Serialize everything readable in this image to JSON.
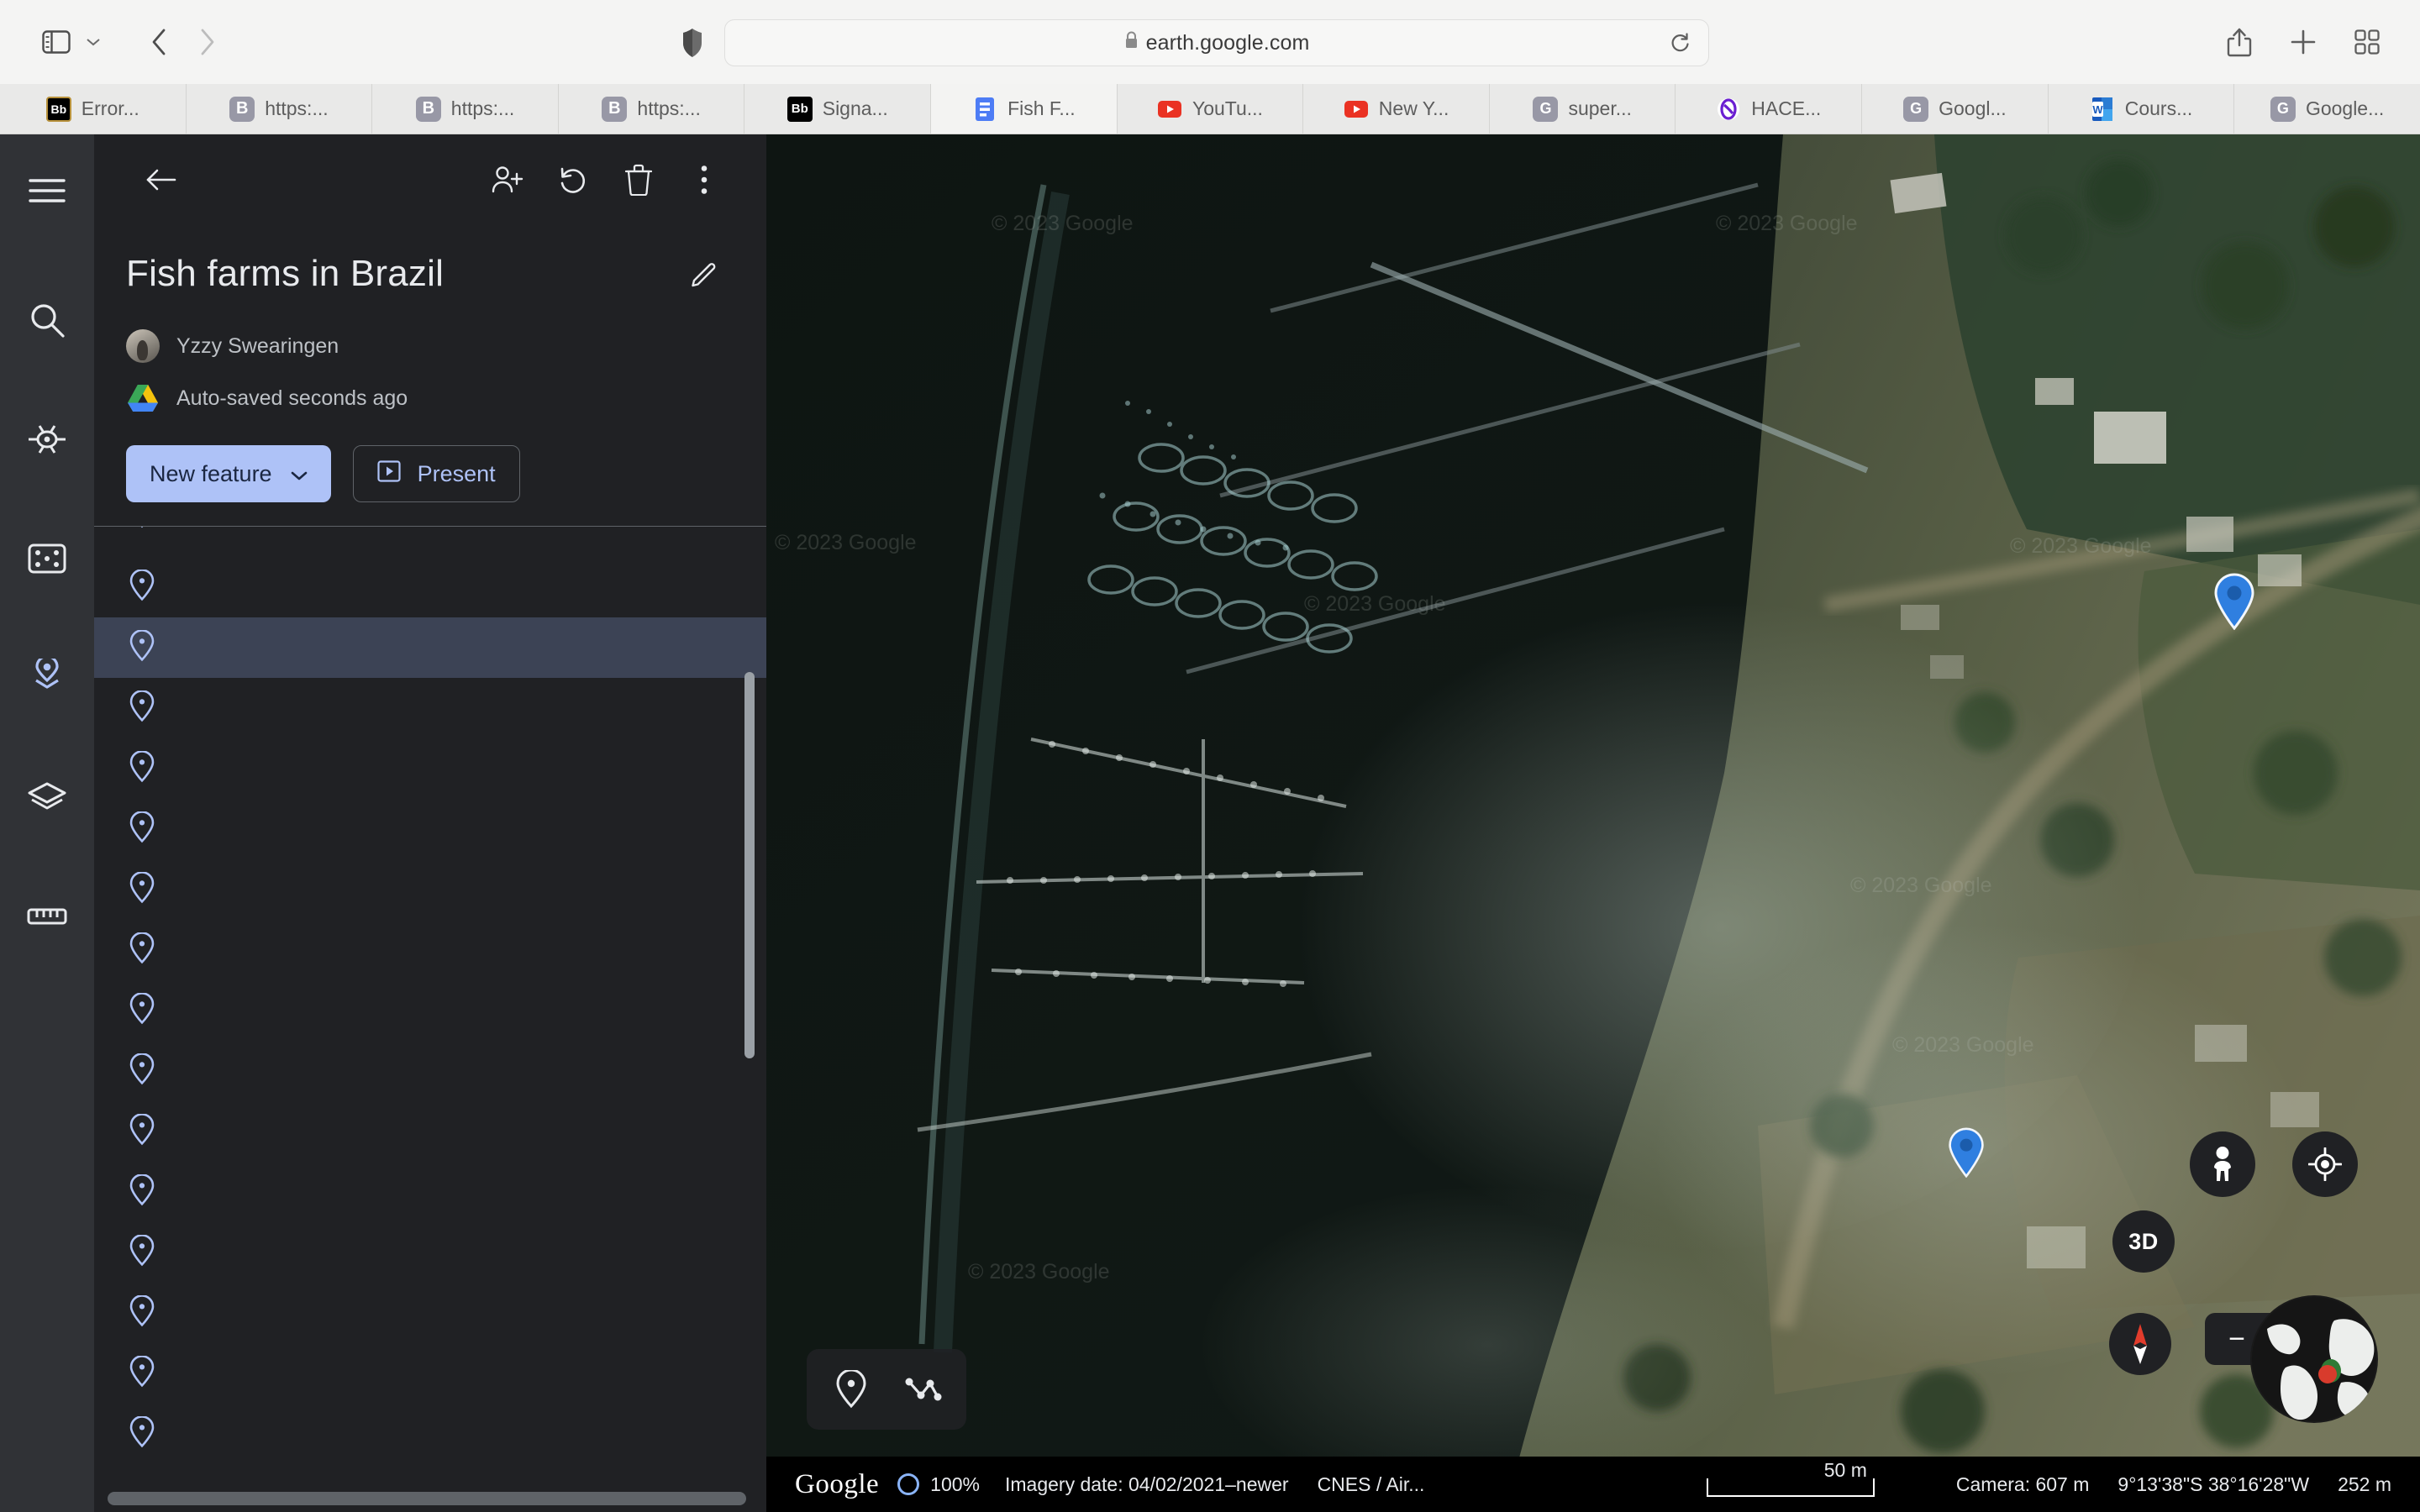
{
  "browser": {
    "url": "earth.google.com",
    "lock_icon": "lock-icon",
    "sidebar_icon": "sidebar-toggle-icon",
    "back_icon": "back-arrow-icon",
    "forward_icon": "forward-arrow-icon",
    "shield_icon": "privacy-shield-icon",
    "reload_icon": "reload-icon",
    "share_icon": "share-icon",
    "newtab_icon": "plus-icon",
    "tabgrid_icon": "tab-overview-icon",
    "tabs": [
      {
        "label": "Error...",
        "favicon": "blackboard-icon",
        "favicon_text": "Bb",
        "style": "bb-gold"
      },
      {
        "label": "https:...",
        "favicon": "blackboard-icon",
        "favicon_text": "B",
        "style": "b-gray"
      },
      {
        "label": "https:...",
        "favicon": "blackboard-icon",
        "favicon_text": "B",
        "style": "b-gray"
      },
      {
        "label": "https:...",
        "favicon": "blackboard-icon",
        "favicon_text": "B",
        "style": "b-gray"
      },
      {
        "label": "Signa...",
        "favicon": "blackboard-icon",
        "favicon_text": "Bb",
        "style": "bb-black"
      },
      {
        "label": "Fish F...",
        "favicon": "google-docs-icon",
        "favicon_text": "",
        "style": "doc"
      },
      {
        "label": "YouTu...",
        "favicon": "youtube-icon",
        "favicon_text": "",
        "style": "yt"
      },
      {
        "label": "New Y...",
        "favicon": "youtube-icon",
        "favicon_text": "",
        "style": "yt"
      },
      {
        "label": "super...",
        "favicon": "google-icon",
        "favicon_text": "G",
        "style": "g-gray"
      },
      {
        "label": "HACE...",
        "favicon": "hace-icon",
        "favicon_text": "",
        "style": "hace"
      },
      {
        "label": "Googl...",
        "favicon": "google-icon",
        "favicon_text": "G",
        "style": "g-gray"
      },
      {
        "label": "Cours...",
        "favicon": "word-icon",
        "favicon_text": "W",
        "style": "word"
      },
      {
        "label": "Google...",
        "favicon": "google-icon",
        "favicon_text": "G",
        "style": "g-gray"
      }
    ]
  },
  "rail": {
    "items": [
      {
        "name": "menu-icon",
        "active": false
      },
      {
        "name": "search-icon",
        "active": false
      },
      {
        "name": "voyager-icon",
        "active": false
      },
      {
        "name": "im-feeling-lucky-icon",
        "active": false
      },
      {
        "name": "my-places-icon",
        "active": true
      },
      {
        "name": "layers-icon",
        "active": false
      },
      {
        "name": "measure-icon",
        "active": false
      }
    ]
  },
  "panel": {
    "back_label": "back-arrow-icon",
    "add_collaborator_label": "add-person-icon",
    "undo_label": "undo-icon",
    "delete_label": "delete-icon",
    "more_label": "more-options-icon",
    "title": "Fish farms in Brazil",
    "edit_icon": "pencil-edit-icon",
    "owner": "Yzzy Swearingen",
    "save_status": "Auto-saved seconds ago",
    "new_feature_label": "New feature",
    "new_feature_caret": "chevron-down-icon",
    "present_label": "Present",
    "present_icon": "present-play-icon",
    "features": [
      {
        "label": "",
        "selected": false,
        "clipped": true
      },
      {
        "label": "",
        "selected": false,
        "clipped": false
      },
      {
        "label": "",
        "selected": true,
        "clipped": false
      },
      {
        "label": "",
        "selected": false,
        "clipped": false
      },
      {
        "label": "",
        "selected": false,
        "clipped": false
      },
      {
        "label": "",
        "selected": false,
        "clipped": false
      },
      {
        "label": "",
        "selected": false,
        "clipped": false
      },
      {
        "label": "",
        "selected": false,
        "clipped": false
      },
      {
        "label": "",
        "selected": false,
        "clipped": false
      },
      {
        "label": "",
        "selected": false,
        "clipped": false
      },
      {
        "label": "",
        "selected": false,
        "clipped": false
      },
      {
        "label": "",
        "selected": false,
        "clipped": false
      },
      {
        "label": "",
        "selected": false,
        "clipped": false
      },
      {
        "label": "",
        "selected": false,
        "clipped": false
      },
      {
        "label": "",
        "selected": false,
        "clipped": false
      },
      {
        "label": "",
        "selected": false,
        "clipped": false
      }
    ]
  },
  "map": {
    "watermarks": [
      "© 2023 Google",
      "© 2023 Google",
      "© 2023 Google",
      "© 2023 Google",
      "© 2023 Google",
      "© 2023 Google",
      "© 2023 Google",
      "© 2023 Google"
    ],
    "markers": [
      {
        "name": "map-marker-1"
      },
      {
        "name": "map-marker-2"
      }
    ],
    "toolbar": {
      "placemark_icon": "add-placemark-icon",
      "path_icon": "draw-path-icon"
    },
    "controls": {
      "pegman": "street-view-pegman-icon",
      "locate": "my-location-icon",
      "view_mode": "3D",
      "compass": "compass-icon",
      "zoom_out": "−",
      "zoom_in": "+",
      "globe": "globe-overview-icon"
    }
  },
  "status": {
    "brand": "Google",
    "zoom_percent": "100%",
    "imagery_date": "Imagery date: 04/02/2021–newer",
    "attribution": "CNES / Air...",
    "scale_label": "50 m",
    "camera": "Camera: 607 m",
    "coordinates": "9°13'38\"S 38°16'28\"W",
    "elevation": "252 m"
  },
  "colors": {
    "accent_blue": "#aec2f7",
    "marker_blue": "#2f7fe0",
    "panel_bg": "#202124",
    "rail_bg": "#303236",
    "selected_row": "#3c4355"
  }
}
